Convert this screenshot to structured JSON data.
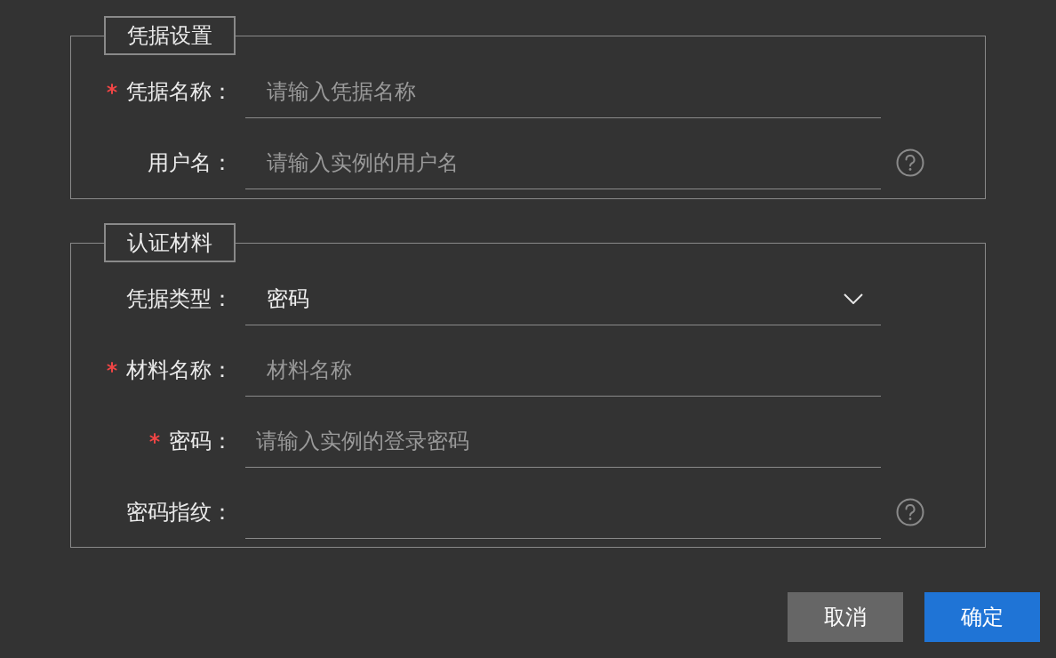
{
  "sections": [
    {
      "title": "凭据设置",
      "fields": [
        {
          "label": "凭据名称：",
          "required": true,
          "kind": "text",
          "placeholder": "请输入凭据名称",
          "help": false
        },
        {
          "label": "用户名：",
          "required": false,
          "kind": "text",
          "placeholder": "请输入实例的用户名",
          "help": true
        }
      ]
    },
    {
      "title": "认证材料",
      "fields": [
        {
          "label": "凭据类型：",
          "required": false,
          "kind": "select",
          "value": "密码",
          "help": false
        },
        {
          "label": "材料名称：",
          "required": true,
          "kind": "text",
          "placeholder": "材料名称",
          "help": false
        },
        {
          "label": "密码：",
          "required": true,
          "kind": "password",
          "placeholder": "请输入实例的登录密码",
          "help": false
        },
        {
          "label": "密码指纹：",
          "required": false,
          "kind": "text",
          "help": true
        }
      ]
    }
  ],
  "buttons": [
    {
      "label": "取消",
      "kind": "secondary"
    },
    {
      "label": "确定",
      "kind": "primary"
    }
  ]
}
